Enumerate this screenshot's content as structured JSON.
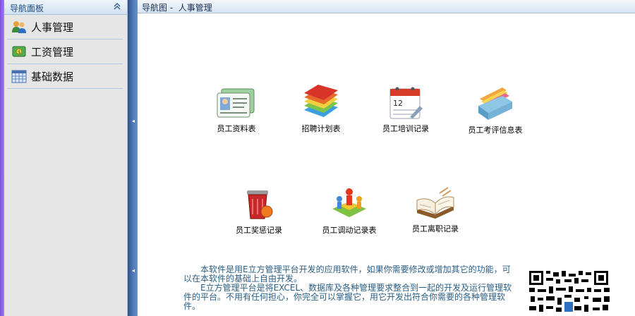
{
  "nav": {
    "title": "导航面板",
    "items": [
      {
        "label": "人事管理",
        "icon": "users-icon"
      },
      {
        "label": "工资管理",
        "icon": "money-icon"
      },
      {
        "label": "基础数据",
        "icon": "calendar-grid-icon"
      }
    ]
  },
  "breadcrumb": "导航图 -  人事管理",
  "modules": [
    {
      "label": "员工资料表",
      "icon": "employee-card-icon"
    },
    {
      "label": "招聘计划表",
      "icon": "books-icon"
    },
    {
      "label": "员工培训记录",
      "icon": "calendar-icon"
    },
    {
      "label": "员工考评信息表",
      "icon": "file-box-icon"
    },
    {
      "label": "员工奖惩记录",
      "icon": "trash-bin-icon"
    },
    {
      "label": "员工调动记录表",
      "icon": "people-puzzle-icon"
    },
    {
      "label": "员工离职记录",
      "icon": "open-book-icon"
    }
  ],
  "description": [
    "本软件是用E立方管理平台开发的应用软件，如果你需要修改或增加其它的功能，可以在本软件的基础上自由开发。",
    "E立方管理平台是将EXCEL、数据库及各种管理要求整合到一起的开发及运行管理软件的平台。不用有任何担心，你完全可以掌握它，用它开发出符合你需要的各种管理软件。"
  ],
  "colors": {
    "frame": "#7b4fe0",
    "splitter": "#3a5f9a",
    "text_accent": "#2a5f86"
  }
}
